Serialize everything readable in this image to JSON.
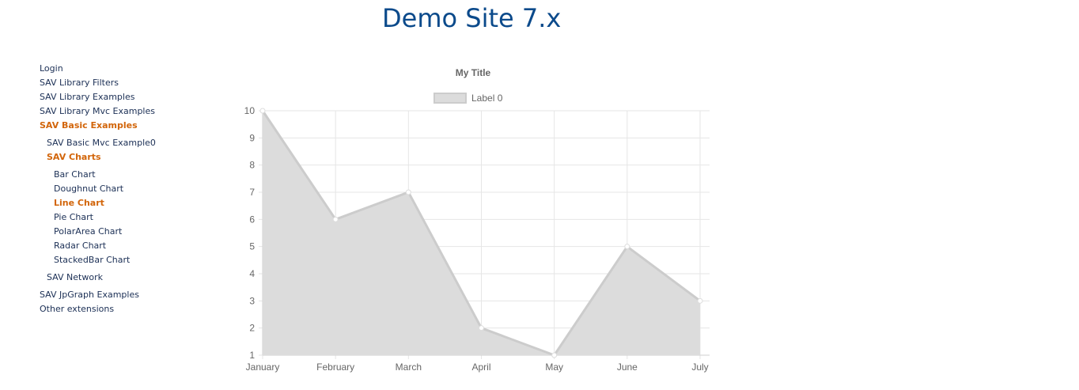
{
  "site": {
    "title": "Demo Site 7.x"
  },
  "nav": {
    "items": [
      {
        "label": "Login",
        "level": 0,
        "active": false
      },
      {
        "label": "SAV Library Filters",
        "level": 0,
        "active": false
      },
      {
        "label": "SAV Library Examples",
        "level": 0,
        "active": false
      },
      {
        "label": "SAV Library Mvc Examples",
        "level": 0,
        "active": false
      },
      {
        "label": "SAV Basic Examples",
        "level": 0,
        "active": true
      },
      {
        "label": "SAV Basic Mvc Example0",
        "level": 1,
        "active": false
      },
      {
        "label": "SAV Charts",
        "level": 1,
        "active": true
      },
      {
        "label": "Bar Chart",
        "level": 2,
        "active": false
      },
      {
        "label": "Doughnut Chart",
        "level": 2,
        "active": false
      },
      {
        "label": "Line Chart",
        "level": 2,
        "active": true
      },
      {
        "label": "Pie Chart",
        "level": 2,
        "active": false
      },
      {
        "label": "PolarArea Chart",
        "level": 2,
        "active": false
      },
      {
        "label": "Radar Chart",
        "level": 2,
        "active": false
      },
      {
        "label": "StackedBar Chart",
        "level": 2,
        "active": false
      },
      {
        "label": "SAV Network",
        "level": 1,
        "active": false
      },
      {
        "label": "SAV JpGraph Examples",
        "level": 0,
        "active": false
      },
      {
        "label": "Other extensions",
        "level": 0,
        "active": false
      }
    ],
    "active_color": "#d2650a",
    "link_color": "#1b2f55"
  },
  "chart_data": {
    "type": "area",
    "title": "My Title",
    "categories": [
      "January",
      "February",
      "March",
      "April",
      "May",
      "June",
      "July"
    ],
    "series": [
      {
        "name": "Label 0",
        "values": [
          10,
          6,
          7,
          2,
          1,
          5,
          3
        ],
        "fill": "#dcdcdc",
        "stroke": "#cccccc"
      }
    ],
    "y_ticks": [
      1,
      2,
      3,
      4,
      5,
      6,
      7,
      8,
      9,
      10
    ],
    "ylim": [
      1,
      10
    ],
    "grid": true,
    "legend": "top"
  }
}
